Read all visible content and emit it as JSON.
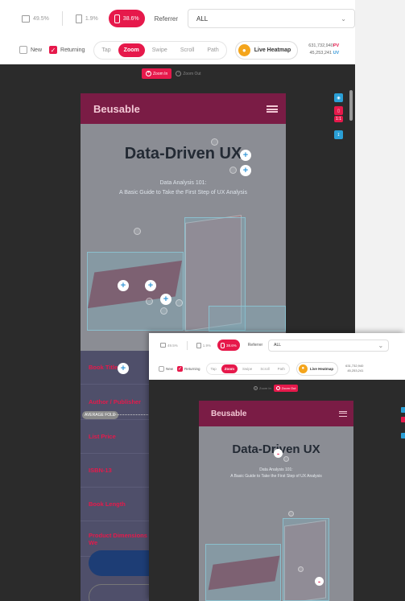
{
  "toolbar": {
    "devices": [
      {
        "label": "49.5%",
        "icon": "desktop-icon"
      },
      {
        "label": "1.9%",
        "icon": "tablet-icon"
      },
      {
        "label": "38.6%",
        "icon": "mobile-icon",
        "active": true
      }
    ],
    "referrer_label": "Referrer",
    "referrer_value": "ALL",
    "filters": {
      "new_label": "New",
      "new_checked": false,
      "returning_label": "Returning",
      "returning_checked": true
    },
    "modes": [
      "Tap",
      "Zoom",
      "Swipe",
      "Scroll",
      "Path"
    ],
    "active_mode": "Zoom",
    "live_heatmap_label": "Live Heatmap",
    "pv_value": "631,732,940",
    "pv_label": "PV",
    "uv_value": "45,253,241",
    "uv_label": "UV"
  },
  "zoom_controls": {
    "zoom_in": "Zoom In",
    "zoom_out": "Zoom Out"
  },
  "preview": {
    "brand": "Beusable",
    "headline": "Data-Driven UX",
    "subtitle_line1": "Data Analysis 101:",
    "subtitle_line2": "A Basic Guide to Take the First Step of UX Analysis",
    "table_rows": [
      "Book Title",
      "Author / Publisher",
      "List Price",
      "ISBN-13",
      "Book Length",
      "Product Dimensions / We"
    ],
    "average_fold_label": "AVERAGE FOLD"
  },
  "side_tools": [
    {
      "icon": "eye-icon",
      "color": "#2a9fd6"
    },
    {
      "icon": "mobile-badge-icon",
      "color": "#e6194b",
      "label": "1:1"
    },
    {
      "icon": "download-icon",
      "color": "#2a9fd6"
    }
  ],
  "inset": {
    "devices": [
      {
        "label": "49.5%"
      },
      {
        "label": "1.9%"
      },
      {
        "label": "38.6%",
        "active": true
      }
    ],
    "referrer_label": "Referrer",
    "referrer_value": "ALL",
    "new_label": "New",
    "returning_label": "Returning",
    "modes": [
      "Tap",
      "Zoom",
      "Swipe",
      "Scroll",
      "Path"
    ],
    "live_heatmap_label": "Live Heatmap",
    "pv_value": "631,732,940",
    "uv_value": "45,253,241",
    "zoom_in": "Zoom In",
    "zoom_out": "Zoom Out",
    "active_zoom": "Zoom Out",
    "brand": "Beusable",
    "headline": "Data-Driven UX",
    "subtitle_line1": "Data Analysis 101:",
    "subtitle_line2": "A Basic Guide to Take the First Step of UX Analysis"
  },
  "colors": {
    "accent": "#e6194b",
    "brand_bar": "#7a1c45",
    "blue": "#3a9ad9",
    "dark_bg": "#2b2b2b"
  }
}
